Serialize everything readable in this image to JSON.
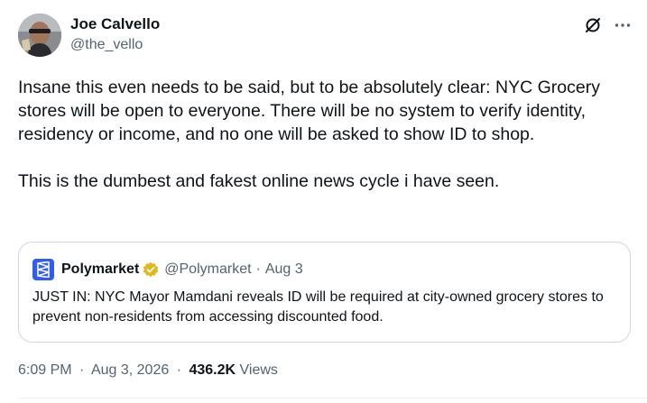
{
  "author": {
    "name": "Joe Calvello",
    "handle": "@the_vello"
  },
  "header_actions": {
    "grok_icon": "grok-slash-icon",
    "more_icon": "more-dots-icon"
  },
  "tweet": {
    "paragraphs": [
      "Insane this even needs to be said, but to be absolutely clear: NYC Grocery stores will be open to everyone. There will be no system to verify identity, residency or income, and no one will be asked to show ID to shop.",
      "This is the dumbest and fakest online news cycle i have seen."
    ]
  },
  "quote": {
    "name": "Polymarket",
    "handle": "@Polymarket",
    "separator": "·",
    "date": "Aug 3",
    "text": "JUST IN: NYC Mayor Mamdani reveals ID will be required at city-owned grocery stores to prevent non-residents from accessing discounted food.",
    "logo_color": "#2e5cff",
    "verified_color": "#e2b719"
  },
  "meta": {
    "time": "6:09 PM",
    "separator": "·",
    "date": "Aug 3, 2026",
    "views_count": "436.2K",
    "views_label": "Views"
  },
  "colors": {
    "text_primary": "#0f1419",
    "text_secondary": "#536471",
    "border": "#cfd9de"
  }
}
